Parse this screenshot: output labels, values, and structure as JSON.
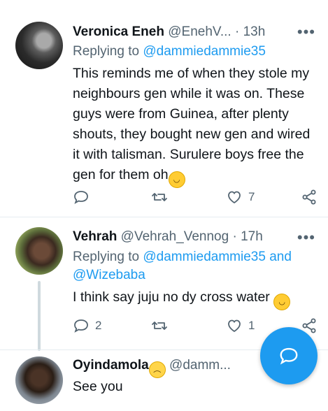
{
  "tweets": [
    {
      "name": "Veronica Eneh",
      "handle": "@EnehV...",
      "sep": "·",
      "time": "13h",
      "replying_label": "Replying to",
      "replying_to": "@dammiedammie35",
      "text": "This reminds me of when they stole my neighbours gen while it was on. These guys were from Guinea, after plenty shouts, they bought new gen and wired it with talisman. Surulere boys free the gen for them oh",
      "emoji": "😂",
      "reply_count": "",
      "retweet_count": "",
      "like_count": "7"
    },
    {
      "name": "Vehrah",
      "handle": "@Vehrah_Vennog",
      "sep": "·",
      "time": "17h",
      "replying_label": "Replying to",
      "replying_to": "@dammiedammie35 and",
      "replying_to_2": "@Wizebaba",
      "text": "I think say juju no dy cross water",
      "emoji": "😂",
      "reply_count": "2",
      "retweet_count": "",
      "like_count": "1"
    },
    {
      "name": "Oyindamola",
      "name_emoji": "🙁",
      "handle": "@damm...",
      "text": "See you"
    }
  ],
  "more_glyph": "•••",
  "colors": {
    "accent": "#1d9bf0",
    "muted": "#536471",
    "text": "#0f1419"
  },
  "icons": [
    "reply-icon",
    "retweet-icon",
    "like-icon",
    "share-icon",
    "compose-reply-icon"
  ]
}
